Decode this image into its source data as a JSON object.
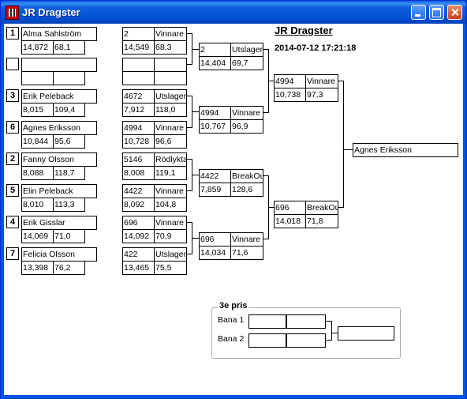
{
  "window": {
    "title": "JR Dragster"
  },
  "header": {
    "title": "JR Dragster",
    "datetime": "2014-07-12 17:21:18"
  },
  "round1": [
    {
      "seed": "1",
      "name": "Alma Sahlström",
      "rt": "14,872",
      "speed": "68,1"
    },
    {
      "seed": "",
      "name": "",
      "rt": "",
      "speed": ""
    },
    {
      "seed": "3",
      "name": "Erik Peleback",
      "rt": "8,015",
      "speed": "109,4"
    },
    {
      "seed": "6",
      "name": "Agnes Eriksson",
      "rt": "10,844",
      "speed": "95,6"
    },
    {
      "seed": "2",
      "name": "Fanny Olsson",
      "rt": "8,088",
      "speed": "118,7"
    },
    {
      "seed": "5",
      "name": "Elin Peleback",
      "rt": "8,010",
      "speed": "113,3"
    },
    {
      "seed": "4",
      "name": "Erik Gisslar",
      "rt": "14,069",
      "speed": "71,0"
    },
    {
      "seed": "7",
      "name": "Felicia Olsson",
      "rt": "13,398",
      "speed": "76,2"
    }
  ],
  "round2": [
    {
      "num": "2",
      "result": "Vinnare",
      "rt": "14,549",
      "speed": "68,3"
    },
    {
      "num": "",
      "result": "",
      "rt": "",
      "speed": ""
    },
    {
      "num": "4672",
      "result": "Utslagen",
      "rt": "7,912",
      "speed": "118,0"
    },
    {
      "num": "4994",
      "result": "Vinnare",
      "rt": "10,728",
      "speed": "96,6"
    },
    {
      "num": "5146",
      "result": "Rödlykta",
      "rt": "8,008",
      "speed": "119,1"
    },
    {
      "num": "4422",
      "result": "Vinnare",
      "rt": "8,092",
      "speed": "104,8"
    },
    {
      "num": "696",
      "result": "Vinnare",
      "rt": "14,092",
      "speed": "70,9"
    },
    {
      "num": "422",
      "result": "Utslagen",
      "rt": "13,465",
      "speed": "75,5"
    }
  ],
  "round3": [
    {
      "num": "2",
      "result": "Utslagen",
      "rt": "14,404",
      "speed": "69,7"
    },
    {
      "num": "4994",
      "result": "Vinnare",
      "rt": "10,767",
      "speed": "96,9"
    },
    {
      "num": "4422",
      "result": "BreakOut",
      "rt": "7,859",
      "speed": "128,6"
    },
    {
      "num": "696",
      "result": "Vinnare",
      "rt": "14,034",
      "speed": "71,6"
    }
  ],
  "round4": [
    {
      "num": "4994",
      "result": "Vinnare",
      "rt": "10,738",
      "speed": "97,3"
    },
    {
      "num": "696",
      "result": "BreakOut",
      "rt": "14,018",
      "speed": "71,8"
    }
  ],
  "final": {
    "winner": "Agnes Eriksson"
  },
  "third_place": {
    "legend": "3e pris",
    "lane1": "Bana 1",
    "lane2": "Bana 2"
  }
}
